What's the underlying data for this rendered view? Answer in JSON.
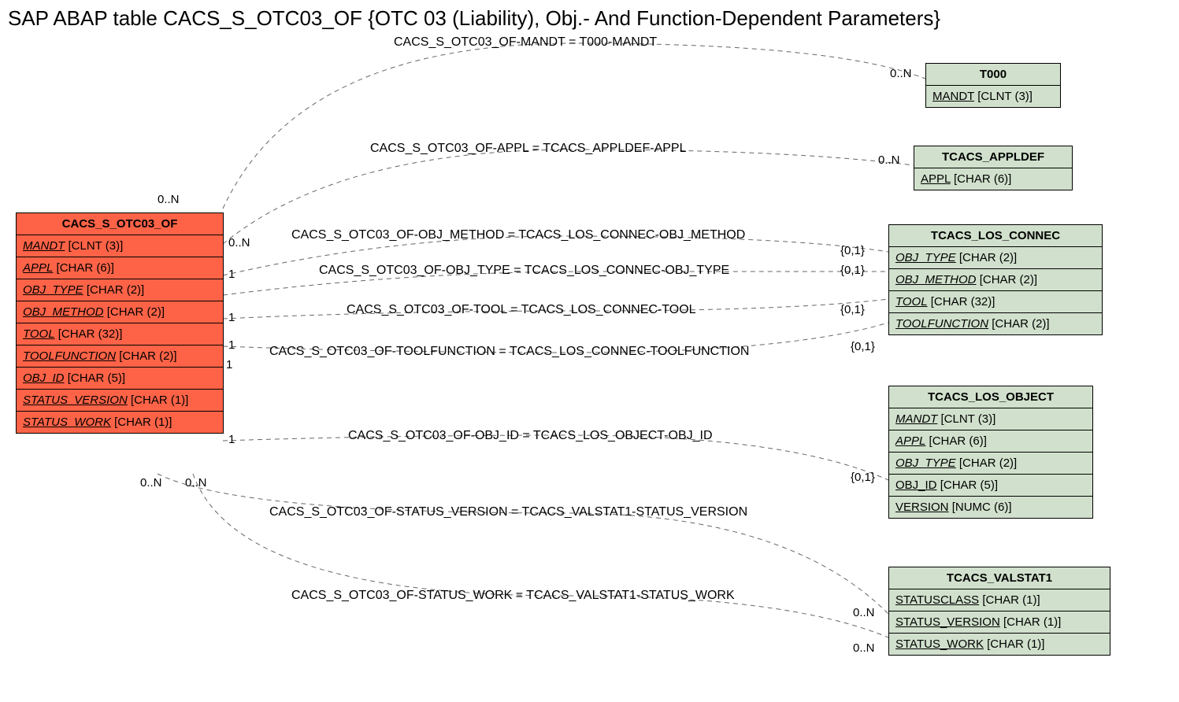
{
  "title": "SAP ABAP table CACS_S_OTC03_OF {OTC 03 (Liability), Obj.- And Function-Dependent Parameters}",
  "main_table": {
    "name": "CACS_S_OTC03_OF",
    "fields": [
      {
        "name": "MANDT",
        "type": "[CLNT (3)]",
        "fk": true
      },
      {
        "name": "APPL",
        "type": "[CHAR (6)]",
        "fk": true
      },
      {
        "name": "OBJ_TYPE",
        "type": "[CHAR (2)]",
        "fk": true
      },
      {
        "name": "OBJ_METHOD",
        "type": "[CHAR (2)]",
        "fk": true
      },
      {
        "name": "TOOL",
        "type": "[CHAR (32)]",
        "fk": true
      },
      {
        "name": "TOOLFUNCTION",
        "type": "[CHAR (2)]",
        "fk": true
      },
      {
        "name": "OBJ_ID",
        "type": "[CHAR (5)]",
        "fk": true
      },
      {
        "name": "STATUS_VERSION",
        "type": "[CHAR (1)]",
        "fk": true
      },
      {
        "name": "STATUS_WORK",
        "type": "[CHAR (1)]",
        "fk": true
      }
    ]
  },
  "tables": {
    "t000": {
      "name": "T000",
      "fields": [
        {
          "name": "MANDT",
          "type": "[CLNT (3)]",
          "pk": true
        }
      ]
    },
    "appldef": {
      "name": "TCACS_APPLDEF",
      "fields": [
        {
          "name": "APPL",
          "type": "[CHAR (6)]",
          "pk": true
        }
      ]
    },
    "los_connec": {
      "name": "TCACS_LOS_CONNEC",
      "fields": [
        {
          "name": "OBJ_TYPE",
          "type": "[CHAR (2)]",
          "fk": true
        },
        {
          "name": "OBJ_METHOD",
          "type": "[CHAR (2)]",
          "fk": true
        },
        {
          "name": "TOOL",
          "type": "[CHAR (32)]",
          "fk": true
        },
        {
          "name": "TOOLFUNCTION",
          "type": "[CHAR (2)]",
          "fk": true
        }
      ]
    },
    "los_object": {
      "name": "TCACS_LOS_OBJECT",
      "fields": [
        {
          "name": "MANDT",
          "type": "[CLNT (3)]",
          "fk": true
        },
        {
          "name": "APPL",
          "type": "[CHAR (6)]",
          "fk": true
        },
        {
          "name": "OBJ_TYPE",
          "type": "[CHAR (2)]",
          "fk": true
        },
        {
          "name": "OBJ_ID",
          "type": "[CHAR (5)]",
          "pk": true
        },
        {
          "name": "VERSION",
          "type": "[NUMC (6)]",
          "pk": true
        }
      ]
    },
    "valstat1": {
      "name": "TCACS_VALSTAT1",
      "fields": [
        {
          "name": "STATUSCLASS",
          "type": "[CHAR (1)]",
          "pk": true
        },
        {
          "name": "STATUS_VERSION",
          "type": "[CHAR (1)]",
          "pk": true
        },
        {
          "name": "STATUS_WORK",
          "type": "[CHAR (1)]",
          "pk": true
        }
      ]
    }
  },
  "edges": [
    {
      "label": "CACS_S_OTC03_OF-MANDT = T000-MANDT",
      "left_card": "0..N",
      "right_card": "0..N"
    },
    {
      "label": "CACS_S_OTC03_OF-APPL = TCACS_APPLDEF-APPL",
      "left_card": "0..N",
      "right_card": "0..N"
    },
    {
      "label": "CACS_S_OTC03_OF-OBJ_METHOD = TCACS_LOS_CONNEC-OBJ_METHOD",
      "left_card": "1",
      "right_card": "{0,1}"
    },
    {
      "label": "CACS_S_OTC03_OF-OBJ_TYPE = TCACS_LOS_CONNEC-OBJ_TYPE",
      "left_card": "",
      "right_card": "{0,1}"
    },
    {
      "label": "CACS_S_OTC03_OF-TOOL = TCACS_LOS_CONNEC-TOOL",
      "left_card": "1",
      "right_card": "{0,1}"
    },
    {
      "label": "CACS_S_OTC03_OF-TOOLFUNCTION = TCACS_LOS_CONNEC-TOOLFUNCTION",
      "left_card": "1",
      "right_card": "{0,1}"
    },
    {
      "label": "CACS_S_OTC03_OF-OBJ_ID = TCACS_LOS_OBJECT-OBJ_ID",
      "left_card": "1",
      "right_card": "{0,1}"
    },
    {
      "label": "CACS_S_OTC03_OF-STATUS_VERSION = TCACS_VALSTAT1-STATUS_VERSION",
      "left_card": "0..N",
      "right_card": "0..N"
    },
    {
      "label": "CACS_S_OTC03_OF-STATUS_WORK = TCACS_VALSTAT1-STATUS_WORK",
      "left_card": "0..N",
      "right_card": "0..N"
    }
  ]
}
